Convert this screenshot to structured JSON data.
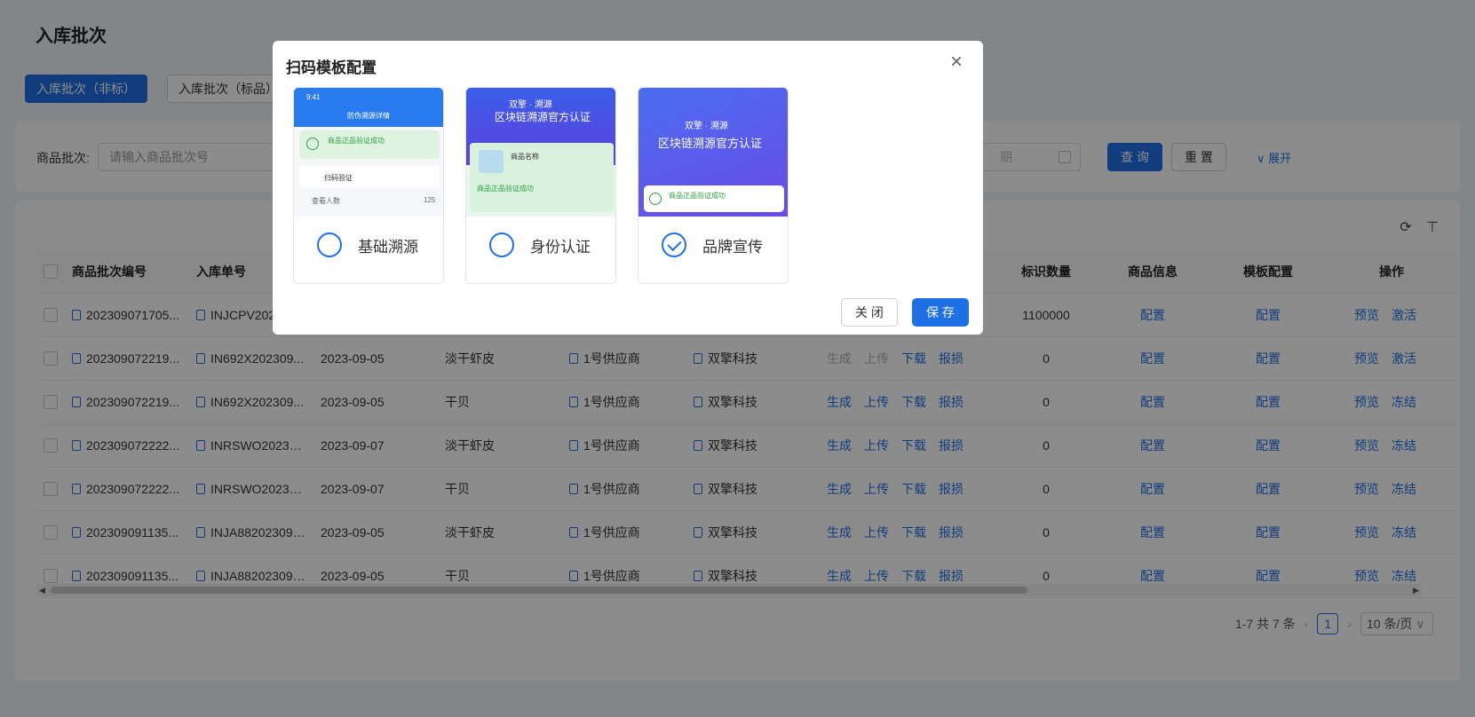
{
  "page": {
    "title": "入库批次",
    "tabs": [
      "入库批次（非标）",
      "入库批次（标品）"
    ]
  },
  "search": {
    "label": "商品批次:",
    "placeholder": "请输入商品批次号",
    "date_placeholder": "期",
    "query_label": "查 询",
    "reset_label": "重 置",
    "expand_label": "展开"
  },
  "table": {
    "columns": [
      "商品批次编号",
      "入库单号",
      "",
      "",
      "",
      "",
      "",
      "标识数量",
      "商品信息",
      "模板配置",
      "操作"
    ],
    "rows": [
      {
        "batch": "202309071705...",
        "order": "INJCPV202...",
        "date": "",
        "product": "",
        "supplier": "",
        "brand": "",
        "gen_disabled": true,
        "count": "1100000",
        "status": "激活"
      },
      {
        "batch": "202309072219...",
        "order": "IN692X202309...",
        "date": "2023-09-05",
        "product": "淡干虾皮",
        "supplier": "1号供应商",
        "brand": "双擎科技",
        "gen_disabled": true,
        "count": "0",
        "status": "激活"
      },
      {
        "batch": "202309072219...",
        "order": "IN692X202309...",
        "date": "2023-09-05",
        "product": "干贝",
        "supplier": "1号供应商",
        "brand": "双擎科技",
        "gen_disabled": false,
        "count": "0",
        "status": "冻结"
      },
      {
        "batch": "202309072222...",
        "order": "INRSWO20230...",
        "date": "2023-09-07",
        "product": "淡干虾皮",
        "supplier": "1号供应商",
        "brand": "双擎科技",
        "gen_disabled": false,
        "count": "0",
        "status": "冻结"
      },
      {
        "batch": "202309072222...",
        "order": "INRSWO20230...",
        "date": "2023-09-07",
        "product": "干贝",
        "supplier": "1号供应商",
        "brand": "双擎科技",
        "gen_disabled": false,
        "count": "0",
        "status": "冻结"
      },
      {
        "batch": "202309091135...",
        "order": "INJA882023090...",
        "date": "2023-09-05",
        "product": "淡干虾皮",
        "supplier": "1号供应商",
        "brand": "双擎科技",
        "gen_disabled": false,
        "count": "0",
        "status": "冻结"
      },
      {
        "batch": "202309091135...",
        "order": "INJA882023090...",
        "date": "2023-09-05",
        "product": "干贝",
        "supplier": "1号供应商",
        "brand": "双擎科技",
        "gen_disabled": false,
        "count": "0",
        "status": "冻结"
      }
    ],
    "actions": {
      "generate": "生成",
      "upload": "上传",
      "download": "下载",
      "damage": "报损",
      "config": "配置",
      "preview": "预览"
    }
  },
  "pagination": {
    "summary": "1-7 共 7 条",
    "current": "1",
    "page_size": "10 条/页"
  },
  "modal": {
    "title": "扫码模板配置",
    "close_label": "关 闭",
    "save_label": "保 存",
    "options": [
      {
        "label": "基础溯源",
        "checked": false,
        "mock": [
          "9:41",
          "防伪溯源详情",
          "商品正品验证成功",
          "扫码验证",
          "查看人数",
          "125"
        ]
      },
      {
        "label": "身份认证",
        "checked": false,
        "mock": [
          "双擎 · 溯源",
          "区块链溯源官方认证",
          "商品名称",
          "商品正品验证成功"
        ]
      },
      {
        "label": "品牌宣传",
        "checked": true,
        "mock": [
          "双擎 · 溯源",
          "区块链溯源官方认证",
          "商品正品验证成功"
        ]
      }
    ]
  },
  "colors": {
    "primary": "#1f6fe5",
    "overlay": "rgba(0,0,0,0.45)"
  }
}
